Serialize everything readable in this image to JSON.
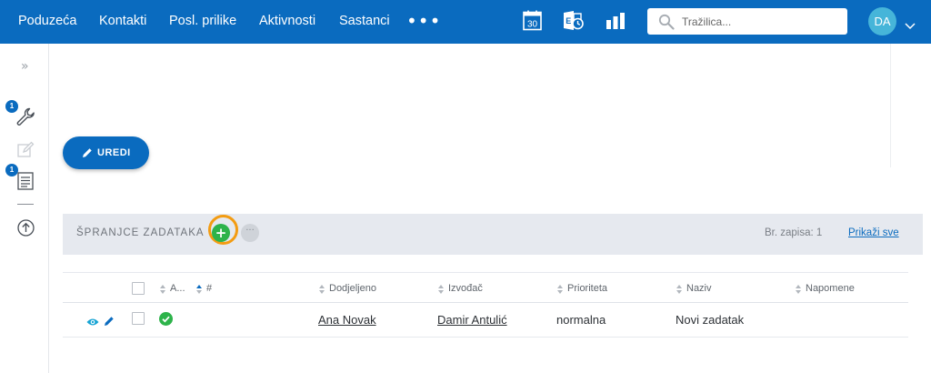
{
  "nav": {
    "items": [
      "Poduzeća",
      "Kontakti",
      "Posl. prilike",
      "Aktivnosti",
      "Sastanci"
    ],
    "more_label": "•••",
    "calendar_day": "30"
  },
  "search": {
    "placeholder": "Tražilica..."
  },
  "user": {
    "initials": "DA"
  },
  "sidebar": {
    "expand_label": "»",
    "badges": [
      "1",
      "1"
    ]
  },
  "edit_button": {
    "label": "UREDI"
  },
  "section": {
    "title": "ŠPRANJCE ZADATAKA",
    "add_label": "+",
    "more_label": "···",
    "record_count": "Br. zapisa: 1",
    "show_all": "Prikaži sve"
  },
  "table": {
    "columns": [
      "A...",
      "#",
      "Dodjeljeno",
      "Izvođač",
      "Prioriteta",
      "Naziv",
      "Napomene"
    ],
    "rows": [
      {
        "assigned": "Ana Novak",
        "contractor": "Damir Antulić",
        "priority": "normalna",
        "name": "Novi zadatak",
        "notes": ""
      }
    ]
  },
  "colors": {
    "brand": "#0a6bbf",
    "success": "#2db34a",
    "highlight": "#f39c12",
    "avatar": "#46b5d9"
  }
}
